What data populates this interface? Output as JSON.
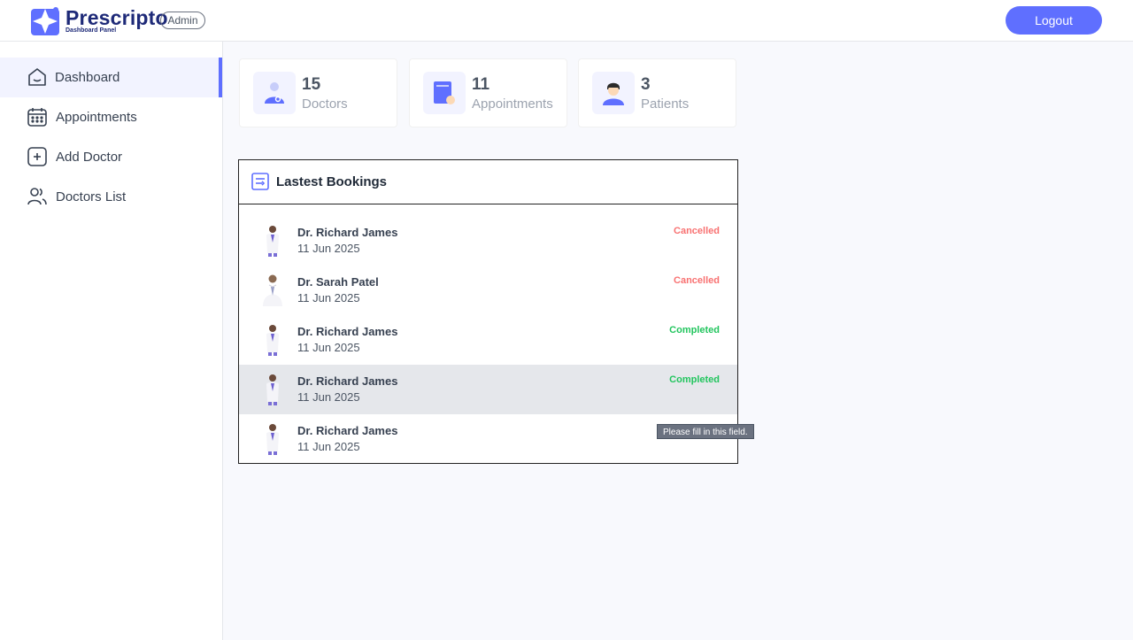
{
  "header": {
    "brand": "Prescripto",
    "brand_sub": "Dashboard Panel",
    "role_badge": "Admin",
    "logout_label": "Logout",
    "accent_color": "#5f6fff"
  },
  "sidebar": {
    "items": [
      {
        "label": "Dashboard",
        "icon": "home-icon",
        "active": true
      },
      {
        "label": "Appointments",
        "icon": "calendar-icon",
        "active": false
      },
      {
        "label": "Add Doctor",
        "icon": "add-icon",
        "active": false
      },
      {
        "label": "Doctors List",
        "icon": "people-icon",
        "active": false
      }
    ]
  },
  "stats": [
    {
      "value": "15",
      "label": "Doctors",
      "icon": "doctor-icon"
    },
    {
      "value": "11",
      "label": "Appointments",
      "icon": "appointments-book-icon"
    },
    {
      "value": "3",
      "label": "Patients",
      "icon": "patient-icon"
    }
  ],
  "bookings": {
    "title": "Lastest Bookings",
    "rows": [
      {
        "name": "Dr. Richard James",
        "date": "11 Jun 2025",
        "status": "Cancelled"
      },
      {
        "name": "Dr. Sarah Patel",
        "date": "11 Jun 2025",
        "status": "Cancelled"
      },
      {
        "name": "Dr. Richard James",
        "date": "11 Jun 2025",
        "status": "Completed"
      },
      {
        "name": "Dr. Richard James",
        "date": "11 Jun 2025",
        "status": "Completed"
      },
      {
        "name": "Dr. Richard James",
        "date": "11 Jun 2025",
        "status": ""
      }
    ]
  },
  "tooltip": "Please fill in this field.",
  "colors": {
    "cancelled": "#f87171",
    "completed": "#22c55e"
  }
}
